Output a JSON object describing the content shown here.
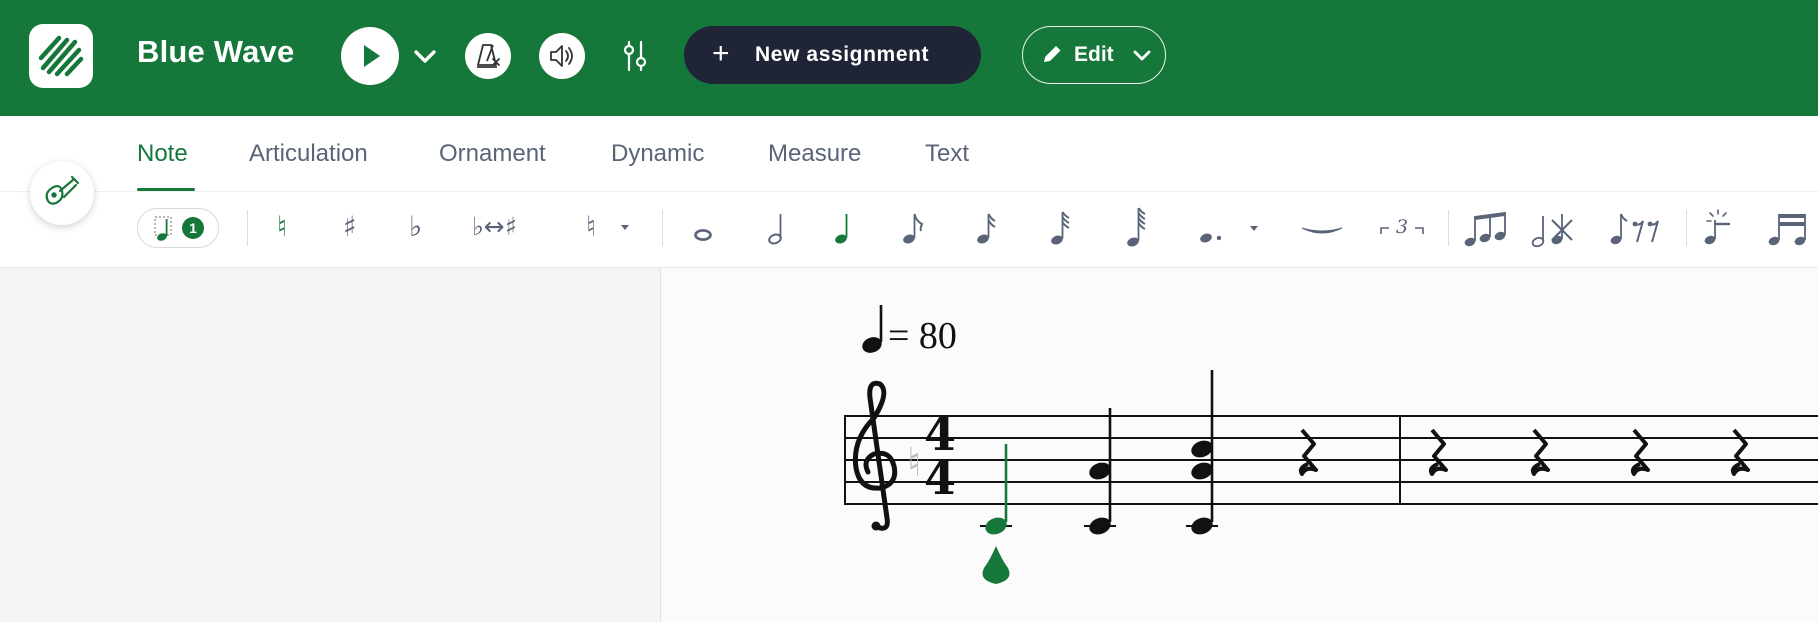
{
  "header": {
    "title": "Blue Wave",
    "new_assignment_label": "New assignment",
    "new_assignment_plus": "+",
    "edit_label": "Edit",
    "brand_color": "#15783a",
    "dark_button_color": "#1f2537",
    "icons": [
      "logo-icon",
      "play-icon",
      "chevron-down-icon",
      "metronome-icon",
      "speaker-icon",
      "mixer-icon",
      "pencil-icon"
    ]
  },
  "tabs": [
    {
      "label": "Note",
      "active": true
    },
    {
      "label": "Articulation",
      "active": false
    },
    {
      "label": "Ornament",
      "active": false
    },
    {
      "label": "Dynamic",
      "active": false
    },
    {
      "label": "Measure",
      "active": false
    },
    {
      "label": "Text",
      "active": false
    }
  ],
  "note_toolbar": {
    "voice_number": "1",
    "accidentals": {
      "natural": "♮",
      "sharp": "♯",
      "flat": "♭",
      "enharmonic": "♭↔♯",
      "cautionary": "♮"
    },
    "durations": [
      "whole-note-icon",
      "half-note-icon",
      "quarter-note-icon",
      "eighth-note-icon",
      "sixteenth-note-icon",
      "thirty-second-note-icon",
      "sixty-fourth-note-icon"
    ],
    "selected_duration": "quarter-note-icon",
    "tuplet_label": "3",
    "accent_color": "#15783a"
  },
  "score": {
    "tempo_value": "= 80",
    "time_signature": {
      "top": "4",
      "bottom": "4"
    },
    "key_signature_marker": "♮",
    "selected_note_color": "#15783a"
  }
}
